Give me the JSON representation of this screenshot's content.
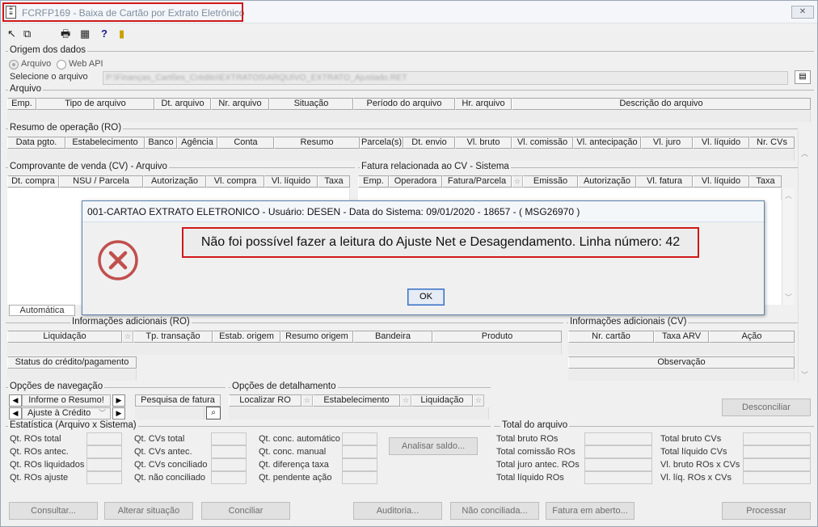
{
  "window": {
    "title": "FCRFP169 - Baixa de Cartão por Extrato Eletrônico",
    "close": "✕"
  },
  "toolbar": [
    "↖",
    "⧉",
    "🖶",
    "▦",
    "?",
    "▮"
  ],
  "origem": {
    "label": "Origem dos dados",
    "radio1": "Arquivo",
    "radio2": "Web API",
    "select_label": "Selecione o arquivo",
    "path": "P:\\Finanças_Cartões_Crédito\\EXTRATOS\\ARQUIVO_EXTRATO_Ajustado.RET"
  },
  "arquivo": {
    "label": "Arquivo",
    "cols": [
      "Emp.",
      "Tipo de arquivo",
      "Dt. arquivo",
      "Nr. arquivo",
      "Situação",
      "Período do arquivo",
      "Hr. arquivo",
      "Descrição do arquivo"
    ]
  },
  "resumo": {
    "label": "Resumo de operação (RO)",
    "cols": [
      "Data pgto.",
      "Estabelecimento",
      "Banco",
      "Agência",
      "Conta",
      "Resumo",
      "Parcela(s)",
      "Dt. envio",
      "Vl. bruto",
      "Vl. comissão",
      "Vl. antecipação",
      "Vl. juro",
      "Vl. líquido",
      "Nr. CVs"
    ]
  },
  "cv": {
    "label": "Comprovante de venda (CV) - Arquivo",
    "cols": [
      "Dt. compra",
      "NSU / Parcela",
      "Autorização",
      "Vl. compra",
      "Vl. líquido",
      "Taxa"
    ]
  },
  "fatura": {
    "label": "Fatura relacionada ao CV - Sistema",
    "cols": [
      "Emp.",
      "Operadora",
      "Fatura/Parcela",
      "Emissão",
      "Autorização",
      "Vl. fatura",
      "Vl. líquido",
      "Taxa"
    ]
  },
  "automatica": "Automática",
  "info_ro": {
    "label": "Informações adicionais (RO)",
    "cols": [
      "Liquidação",
      "Tp. transação",
      "Estab. origem",
      "Resumo origem",
      "Bandeira",
      "Produto"
    ],
    "status": "Status do crédito/pagamento"
  },
  "info_cv": {
    "label": "Informações adicionais (CV)",
    "cols": [
      "Nr. cartão",
      "Taxa ARV",
      "Ação"
    ],
    "obs": "Observação"
  },
  "nav": {
    "label": "Opções de navegação",
    "item1": "Informe o Resumo!",
    "item2": "Ajuste à Crédito",
    "search": "Pesquisa de fatura"
  },
  "detalhe": {
    "label": "Opções de detalhamento",
    "cols": [
      "Localizar RO",
      "Estabelecimento",
      "Liquidação"
    ]
  },
  "desconciliar": "Desconciliar",
  "estat": {
    "label": "Estatística (Arquivo x Sistema)",
    "c1": [
      "Qt. ROs total",
      "Qt. ROs antec.",
      "Qt. ROs liquidados",
      "Qt. ROs ajuste"
    ],
    "c2": [
      "Qt. CVs total",
      "Qt. CVs antec.",
      "Qt. CVs conciliado",
      "Qt. não conciliado"
    ],
    "c3": [
      "Qt. conc. automático",
      "Qt. conc. manual",
      "Qt. diferença taxa",
      "Qt. pendente ação"
    ],
    "analisar": "Analisar saldo..."
  },
  "total": {
    "label": "Total do arquivo",
    "c1": [
      "Total bruto ROs",
      "Total comissão ROs",
      "Total juro antec. ROs",
      "Total líquido ROs"
    ],
    "c2": [
      "Total bruto CVs",
      "Total líquido CVs",
      "Vl. bruto ROs x CVs",
      "Vl. líq. ROs x CVs"
    ]
  },
  "bottom": [
    "Consultar...",
    "Alterar situação",
    "Conciliar",
    "Auditoria...",
    "Não conciliada...",
    "Fatura em aberto...",
    "Processar"
  ],
  "dialog": {
    "title": "001-CARTAO EXTRATO ELETRONICO - Usuário: DESEN - Data do Sistema: 09/01/2020 - 18657 - ( MSG26970 )",
    "message": "Não foi possível fazer a leitura do Ajuste Net e Desagendamento. Linha número: 42",
    "ok": "OK"
  }
}
